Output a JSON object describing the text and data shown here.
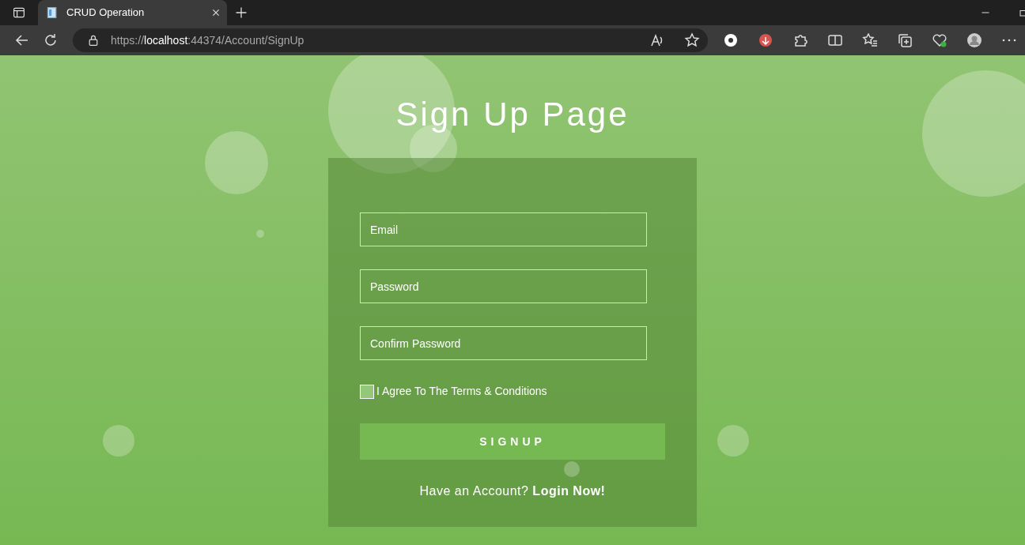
{
  "browser": {
    "tabs": [
      {
        "title": "CRUD Operation",
        "selected": true
      }
    ],
    "address": {
      "scheme": "https://",
      "host": "localhost",
      "path": ":44374/Account/SignUp"
    }
  },
  "page": {
    "title": "Sign Up Page",
    "fields": [
      {
        "placeholder": "Email"
      },
      {
        "placeholder": "Password"
      },
      {
        "placeholder": "Confirm Password"
      }
    ],
    "terms": {
      "label": "I Agree To The Terms & Conditions",
      "checked": false
    },
    "submit": "SIGNUP",
    "prompt": {
      "text": "Have an Account?",
      "link": "Login Now!"
    }
  }
}
